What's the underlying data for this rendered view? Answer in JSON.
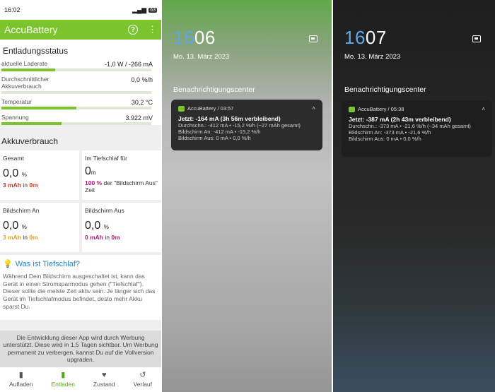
{
  "app": {
    "status_time": "16:02",
    "status_battery": "63",
    "title": "AccuBattery",
    "help_icon": "?",
    "menu_icon": "⋮",
    "discharge_section": "Entladungsstatus",
    "stats": [
      {
        "label": "aktuelle Laderate",
        "value": "-1,0 W / -266 mA",
        "fill": 0.36
      },
      {
        "label": "Durchschnittlicher Akkuverbrauch",
        "value": "0,0 %/h",
        "fill": 0.0
      },
      {
        "label": "Temperatur",
        "value": "30,2 °C",
        "fill": 0.5
      },
      {
        "label": "Spannung",
        "value": "3.922 mV",
        "fill": 0.4
      }
    ],
    "usage_section": "Akkuverbrauch",
    "tiles": {
      "total": {
        "label": "Gesamt",
        "value": "0,0",
        "unit": "%",
        "sub_a": "3 mAh",
        "sub_mid": " in ",
        "sub_b": "0m"
      },
      "deepsleep": {
        "label": "Im Tiefschlaf für",
        "value": "0",
        "unit": "m",
        "sub_a": "100 %",
        "sub_rest": " der \"Bildschirm Aus\" Zeit"
      },
      "screen_on": {
        "label": "Bildschirm An",
        "value": "0,0",
        "unit": "%",
        "sub_a": "3 mAh",
        "sub_mid": " in ",
        "sub_b": "0m"
      },
      "screen_off": {
        "label": "Bildschirm Aus",
        "value": "0,0",
        "unit": "%",
        "sub_a": "0 mAh",
        "sub_mid": " in ",
        "sub_b": "0m"
      }
    },
    "info_title": "Was ist Tiefschlaf?",
    "info_body": "Während Dein Bildschirm ausgeschaltet ist, kann das Gerät in einen Stromsparmodus gehen (\"Tiefschlaf\"). Dieser sollte die meiste Zeit aktiv sein. Je länger sich das Gerät im Tiefschlafmodus befindet, desto mehr Akku sparst Du.",
    "ad_text": "Die Entwicklung dieser App wird durch Werbung unterstützt. Diese wird in 1,5 Tagen sichtbar. Um Werbung permanent zu verbergen, kannst Du auf die Vollversion upgraden.",
    "nav": [
      {
        "label": "Aufladen",
        "icon": "battery-icon"
      },
      {
        "label": "Entladen",
        "icon": "battery-discharge-icon"
      },
      {
        "label": "Zustand",
        "icon": "heart-icon"
      },
      {
        "label": "Verlauf",
        "icon": "history-icon"
      }
    ]
  },
  "lock1": {
    "time_h": "16",
    "time_m": "06",
    "date": "Mo. 13. März 2023",
    "center": "Benachrichtigungscenter",
    "notif_head": "AccuBattery / 03:57",
    "notif_title": "Jetzt: -164 mA (3h 56m verbleibend)",
    "notif_lines": [
      "Durchschn.: -412 mA  •  -15,2 %/h (~27 mAh gesamt)",
      "Bildschirm An: -412 mA  •  -15,2 %/h",
      "Bildschirm Aus: 0 mA  •  0,0 %/h"
    ]
  },
  "lock2": {
    "time_h": "16",
    "time_m": "07",
    "date": "Mo. 13. März 2023",
    "center": "Benachrichtigungscenter",
    "notif_head": "AccuBattery / 05:38",
    "notif_title": "Jetzt: -387 mA (2h 43m verbleibend)",
    "notif_lines": [
      "Durchschn.: -373 mA  •  -21,6 %/h (~34 mAh gesamt)",
      "Bildschirm An: -373 mA  •  -21,6 %/h",
      "Bildschirm Aus: 0 mA  •  0,0 %/h"
    ]
  }
}
